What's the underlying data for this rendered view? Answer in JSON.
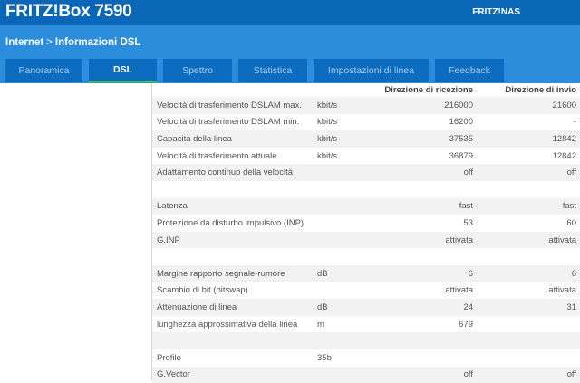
{
  "header": {
    "title": "FRITZ!Box 7590",
    "nas_link": "FRITZ!NAS"
  },
  "breadcrumb": {
    "parent": "Internet",
    "separator": ">",
    "current": "Informazioni DSL"
  },
  "tabs": [
    {
      "label": "Panoramica",
      "w": 85
    },
    {
      "label": "DSL",
      "w": 75,
      "active": true
    },
    {
      "label": "Spettro",
      "w": 76
    },
    {
      "label": "Statistica",
      "w": 76
    },
    {
      "label": "Impostazioni di linea",
      "w": 127
    },
    {
      "label": "Feedback",
      "w": 76
    }
  ],
  "colors": {
    "header": "#0a67b8",
    "subheader": "#2b8ddc",
    "tab": "#0c6cc0",
    "active_underline": "#4fc24f"
  },
  "table": {
    "headers": {
      "receive": "Direzione di ricezione",
      "send": "Direzione di invio"
    },
    "rows": [
      {
        "label": "Velocità di trasferimento DSLAM max.",
        "unit": "kbit/s",
        "rx": "216000",
        "tx": "21600"
      },
      {
        "label": "Velocità di trasferimento DSLAM min.",
        "unit": "kbit/s",
        "rx": "16200",
        "tx": "-"
      },
      {
        "label": "Capacità della linea",
        "unit": "kbit/s",
        "rx": "37535",
        "tx": "12842"
      },
      {
        "label": "Velocità di trasferimento attuale",
        "unit": "kbit/s",
        "rx": "36879",
        "tx": "12842"
      },
      {
        "label": "Adattamento continuo della velocità",
        "unit": "",
        "rx": "off",
        "tx": "off"
      },
      {
        "label": "",
        "unit": "",
        "rx": "",
        "tx": ""
      },
      {
        "label": "Latenza",
        "unit": "",
        "rx": "fast",
        "tx": "fast"
      },
      {
        "label": "Protezione da disturbo impulsivo (INP)",
        "unit": "",
        "rx": "53",
        "tx": "60"
      },
      {
        "label": "G.INP",
        "unit": "",
        "rx": "attivata",
        "tx": "attivata"
      },
      {
        "label": "",
        "unit": "",
        "rx": "",
        "tx": ""
      },
      {
        "label": "Margine rapporto segnale-rumore",
        "unit": "dB",
        "rx": "6",
        "tx": "6"
      },
      {
        "label": "Scambio di bit (bitswap)",
        "unit": "",
        "rx": "attivata",
        "tx": "attivata"
      },
      {
        "label": "Attenuazione di linea",
        "unit": "dB",
        "rx": "24",
        "tx": "31"
      },
      {
        "label": "lunghezza approssimativa della linea",
        "unit": "m",
        "rx": "679",
        "tx": ""
      },
      {
        "label": "",
        "unit": "",
        "rx": "",
        "tx": ""
      },
      {
        "label": "Profilo",
        "unit": "35b",
        "rx": "",
        "tx": ""
      },
      {
        "label": "G.Vector",
        "unit": "",
        "rx": "off",
        "tx": "off"
      }
    ]
  }
}
